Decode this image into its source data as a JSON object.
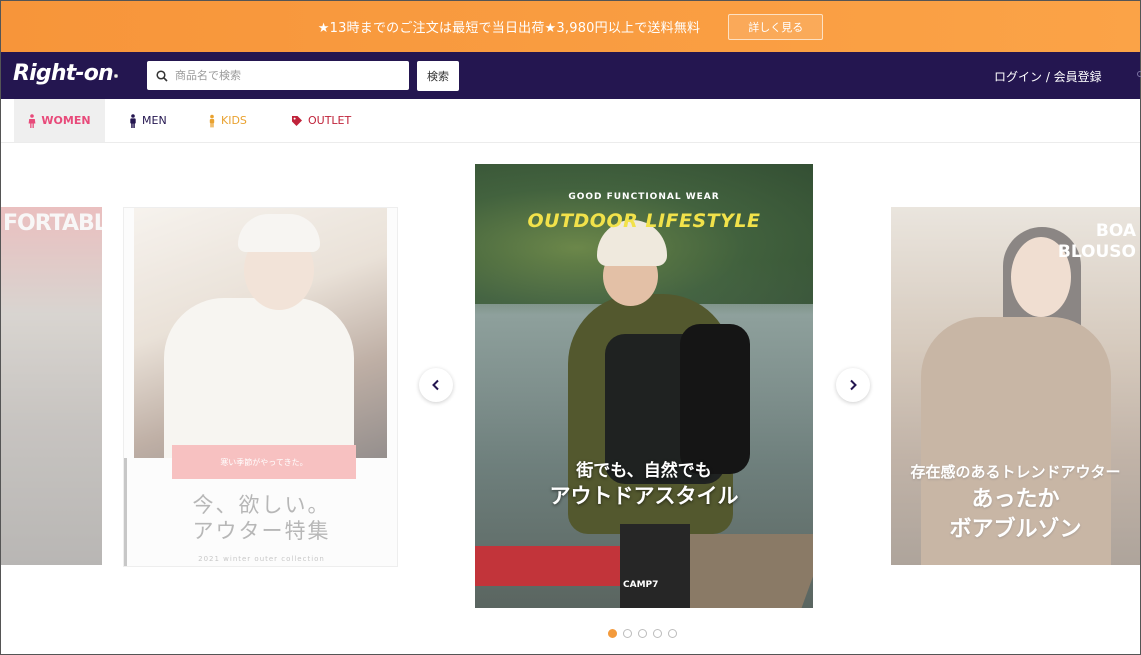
{
  "announcement": {
    "text": "★13時までのご注文は最短で当日出荷★3,980円以上で送料無料",
    "button_label": "詳しく見る"
  },
  "header": {
    "logo_text": "Right-on",
    "search": {
      "placeholder": "商品名で検索",
      "value": ""
    },
    "search_button_label": "検索",
    "login_label": "ログイン / 会員登録"
  },
  "categories": [
    {
      "label": "WOMEN",
      "active": true,
      "color": "#e84a7a",
      "icon": "woman-icon"
    },
    {
      "label": "MEN",
      "active": false,
      "color": "#241650",
      "icon": "man-icon"
    },
    {
      "label": "KIDS",
      "active": false,
      "color": "#e9a230",
      "icon": "kid-icon"
    },
    {
      "label": "OUTLET",
      "active": false,
      "color": "#c0233a",
      "icon": "tag-icon"
    }
  ],
  "carousel": {
    "slides": [
      {
        "text": "FORTABLE"
      },
      {
        "ribbon": "寒い季節がやってきた。",
        "title_line1": "今、欲しい。",
        "title_line2": "アウター特集",
        "subtitle": "2021 winter outer collection"
      },
      {
        "tagline": "GOOD FUNCTIONAL WEAR",
        "headline": "OUTDOOR LIFESTYLE",
        "copy_line1": "街でも、自然でも",
        "copy_line2": "アウトドアスタイル",
        "brand": "CAMP7"
      },
      {
        "en_line1": "BOA",
        "en_line2": "BLOUSO",
        "copy_line1": "存在感のあるトレンドアウター",
        "copy_line2": "あったか",
        "copy_line3": "ボアブルゾン"
      }
    ],
    "dots_count": 5,
    "active_dot": 0
  },
  "colors": {
    "announcement_bg": "#f7953a",
    "header_bg": "#241650",
    "accent": "#f39a3c"
  }
}
